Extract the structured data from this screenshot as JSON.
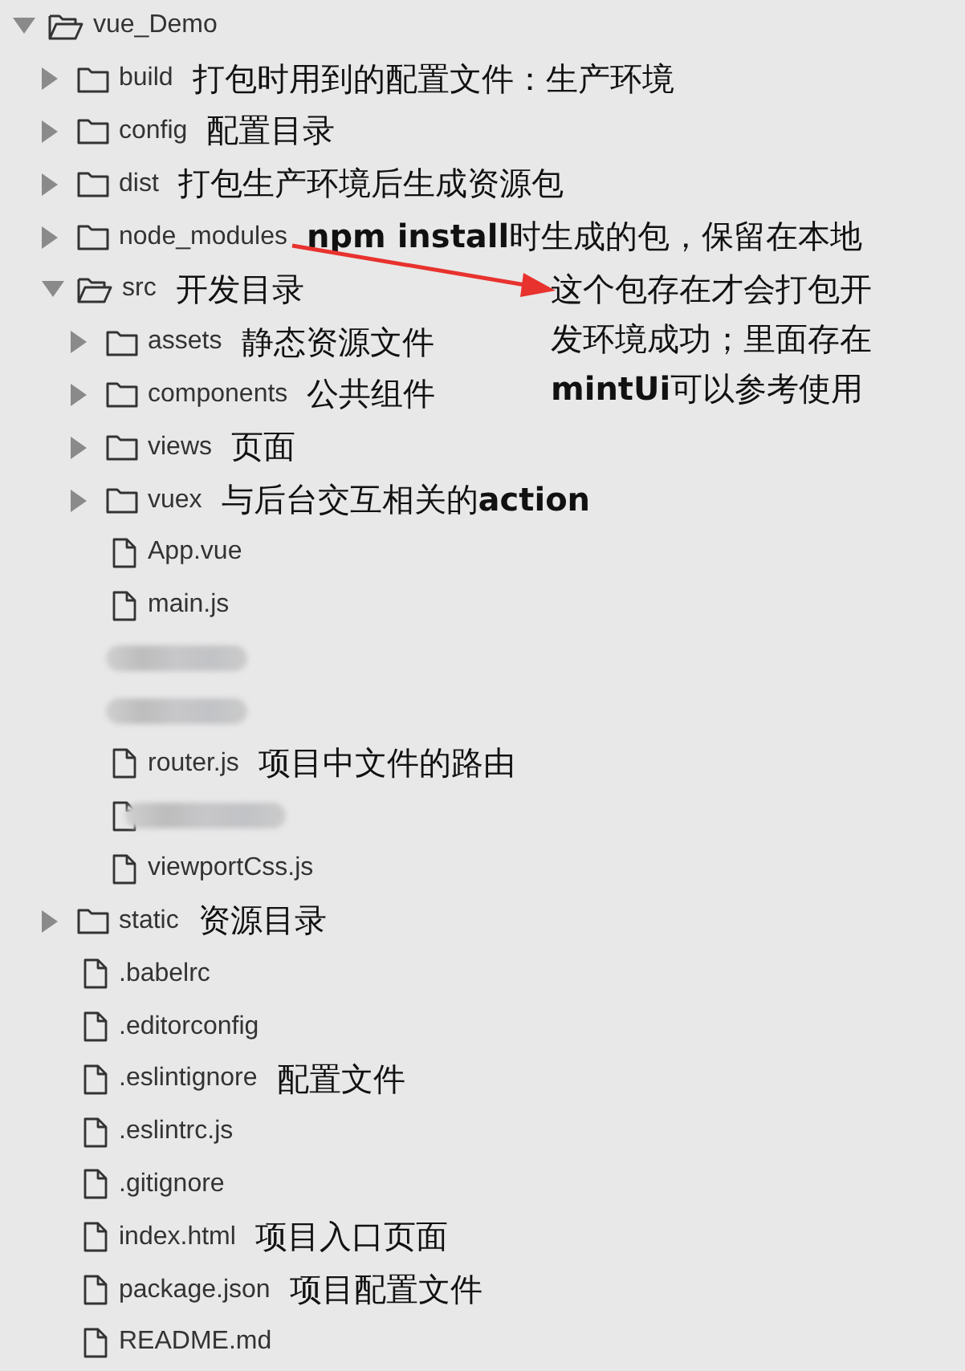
{
  "tree": [
    {
      "kind": "folder",
      "name": "vue_Demo",
      "expanded": true,
      "children": [
        {
          "kind": "folder",
          "name": "build",
          "expanded": false,
          "note": "打包时用到的配置文件：生产环境"
        },
        {
          "kind": "folder",
          "name": "config",
          "expanded": false,
          "note": "配置目录"
        },
        {
          "kind": "folder",
          "name": "dist",
          "expanded": false,
          "note": "打包生产环境后生成资源包"
        },
        {
          "kind": "folder",
          "name": "node_modules",
          "expanded": false,
          "note": "**npm install**时生成的包，保留在本地"
        },
        {
          "kind": "folder",
          "name": "src",
          "expanded": true,
          "note": "开发目录",
          "children": [
            {
              "kind": "folder",
              "name": "assets",
              "expanded": false,
              "note": "静态资源文件"
            },
            {
              "kind": "folder",
              "name": "components",
              "expanded": false,
              "note": "公共组件"
            },
            {
              "kind": "folder",
              "name": "views",
              "expanded": false,
              "note": "页面"
            },
            {
              "kind": "folder",
              "name": "vuex",
              "expanded": false,
              "note": "与后台交互相关的**action**"
            },
            {
              "kind": "file",
              "name": "App.vue"
            },
            {
              "kind": "file",
              "name": "main.js"
            },
            {
              "kind": "redacted"
            },
            {
              "kind": "redacted"
            },
            {
              "kind": "file",
              "name": "router.js",
              "note": "项目中文件的路由"
            },
            {
              "kind": "redacted",
              "icon": true
            },
            {
              "kind": "file",
              "name": "viewportCss.js"
            }
          ]
        },
        {
          "kind": "folder",
          "name": "static",
          "expanded": false,
          "note": "资源目录"
        },
        {
          "kind": "file",
          "name": ".babelrc"
        },
        {
          "kind": "file",
          "name": ".editorconfig"
        },
        {
          "kind": "file",
          "name": ".eslintignore",
          "note": "配置文件"
        },
        {
          "kind": "file",
          "name": ".eslintrc.js"
        },
        {
          "kind": "file",
          "name": ".gitignore"
        },
        {
          "kind": "file",
          "name": "index.html",
          "note": "项目入口页面"
        },
        {
          "kind": "file",
          "name": "package.json",
          "note": "项目配置文件"
        },
        {
          "kind": "file",
          "name": "README.md"
        }
      ]
    }
  ],
  "callout": {
    "lines": [
      "这个包存在才会打包开",
      "发环境成功；里面存在",
      "**mintUi**可以参考使用"
    ]
  }
}
